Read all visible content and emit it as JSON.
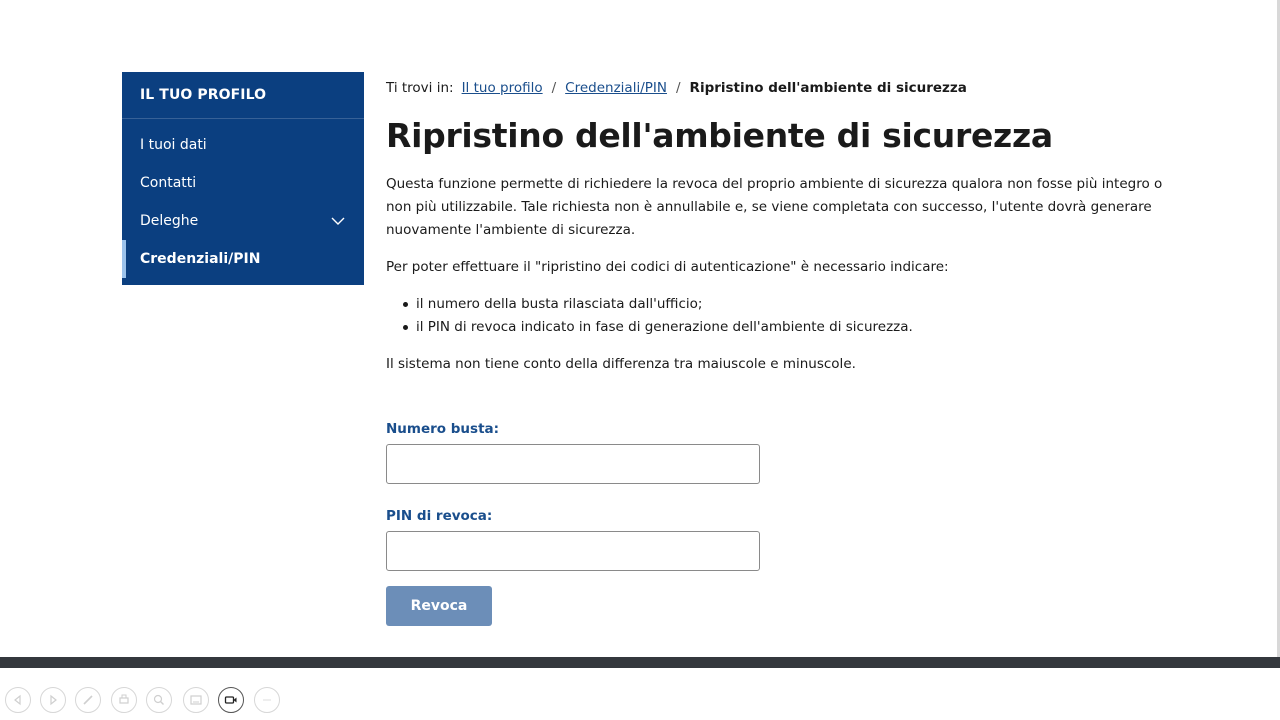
{
  "sidebar": {
    "title": "IL TUO PROFILO",
    "items": [
      {
        "label": "I tuoi dati"
      },
      {
        "label": "Contatti"
      },
      {
        "label": "Deleghe"
      },
      {
        "label": "Credenziali/PIN"
      }
    ]
  },
  "breadcrumb": {
    "prefix": "Ti trovi in:",
    "links": [
      "Il tuo profilo",
      "Credenziali/PIN"
    ],
    "separator": "/",
    "current": "Ripristino dell'ambiente di sicurezza"
  },
  "main": {
    "title": "Ripristino dell'ambiente di sicurezza",
    "intro": "Questa funzione permette di richiedere la revoca del proprio ambiente di sicurezza qualora non fosse più integro o non più utilizzabile. Tale richiesta non è annullabile e, se viene completata con successo, l'utente dovrà generare nuovamente l'ambiente di sicurezza.",
    "requirements_intro": "Per poter effettuare il \"ripristino dei codici di autenticazione\" è necessario indicare:",
    "requirements": [
      "il numero della busta rilasciata dall'ufficio;",
      "il PIN di revoca indicato in fase di generazione dell'ambiente di sicurezza."
    ],
    "note": "Il sistema non tiene conto della differenza tra maiuscole e minuscole."
  },
  "form": {
    "numero_busta_label": "Numero busta:",
    "numero_busta_value": "",
    "pin_revoca_label": "PIN di revoca:",
    "pin_revoca_value": "",
    "submit_label": "Revoca"
  },
  "colors": {
    "sidebar_bg": "#0b3f80",
    "link": "#1a4e8c",
    "button_disabled": "#6c8eb8",
    "footer_bar": "#34383d"
  },
  "player_icons": [
    "prev-icon",
    "play-icon",
    "pen-icon",
    "print-icon",
    "zoom-icon",
    "subtitles-icon",
    "camera-icon",
    "info-icon"
  ]
}
